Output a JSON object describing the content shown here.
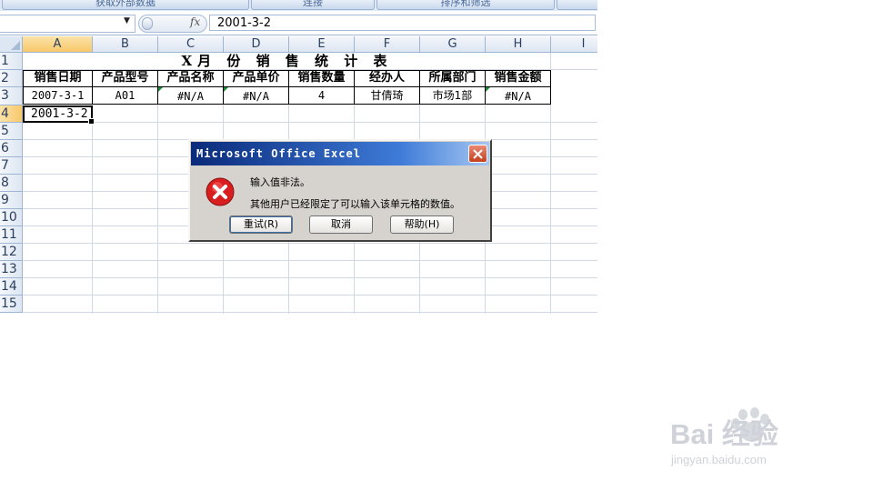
{
  "ribbon": {
    "groups": [
      "获取外部数据",
      "连接",
      "排序和筛选",
      ""
    ]
  },
  "formula_bar": {
    "name_box": "",
    "fx": "fx",
    "value": "2001-3-2"
  },
  "columns": [
    "A",
    "B",
    "C",
    "D",
    "E",
    "F",
    "G",
    "H",
    "I"
  ],
  "rows": [
    "1",
    "2",
    "3",
    "4",
    "5",
    "6",
    "7",
    "8",
    "9",
    "10",
    "11",
    "12",
    "13",
    "14",
    "15"
  ],
  "sheet": {
    "title": "X月 份 销 售 统 计 表",
    "headers": [
      "销售日期",
      "产品型号",
      "产品名称",
      "产品单价",
      "销售数量",
      "经办人",
      "所属部门",
      "销售金额"
    ],
    "row3": [
      "2007-3-1",
      "A01",
      "#N/A",
      "#N/A",
      "4",
      "甘倩琦",
      "市场1部",
      "#N/A"
    ],
    "active_cell_value": "2001-3-2"
  },
  "dialog": {
    "title": "Microsoft Office Excel",
    "message_1": "输入值非法。",
    "message_2": "其他用户已经限定了可以输入该单元格的数值。",
    "buttons": {
      "retry": "重试(R)",
      "cancel": "取消",
      "help": "帮助(H)"
    }
  },
  "watermark": {
    "brand": "Bai 经验",
    "url": "jingyan.baidu.com"
  },
  "colors": {
    "selected_header": "#f8c86a",
    "error_red": "#d81e1e",
    "title_bar": "#0a2a7a",
    "grid": "#d0d7e5"
  },
  "icons": [
    "dropdown-icon",
    "fx-icon",
    "close-icon",
    "error-icon"
  ]
}
